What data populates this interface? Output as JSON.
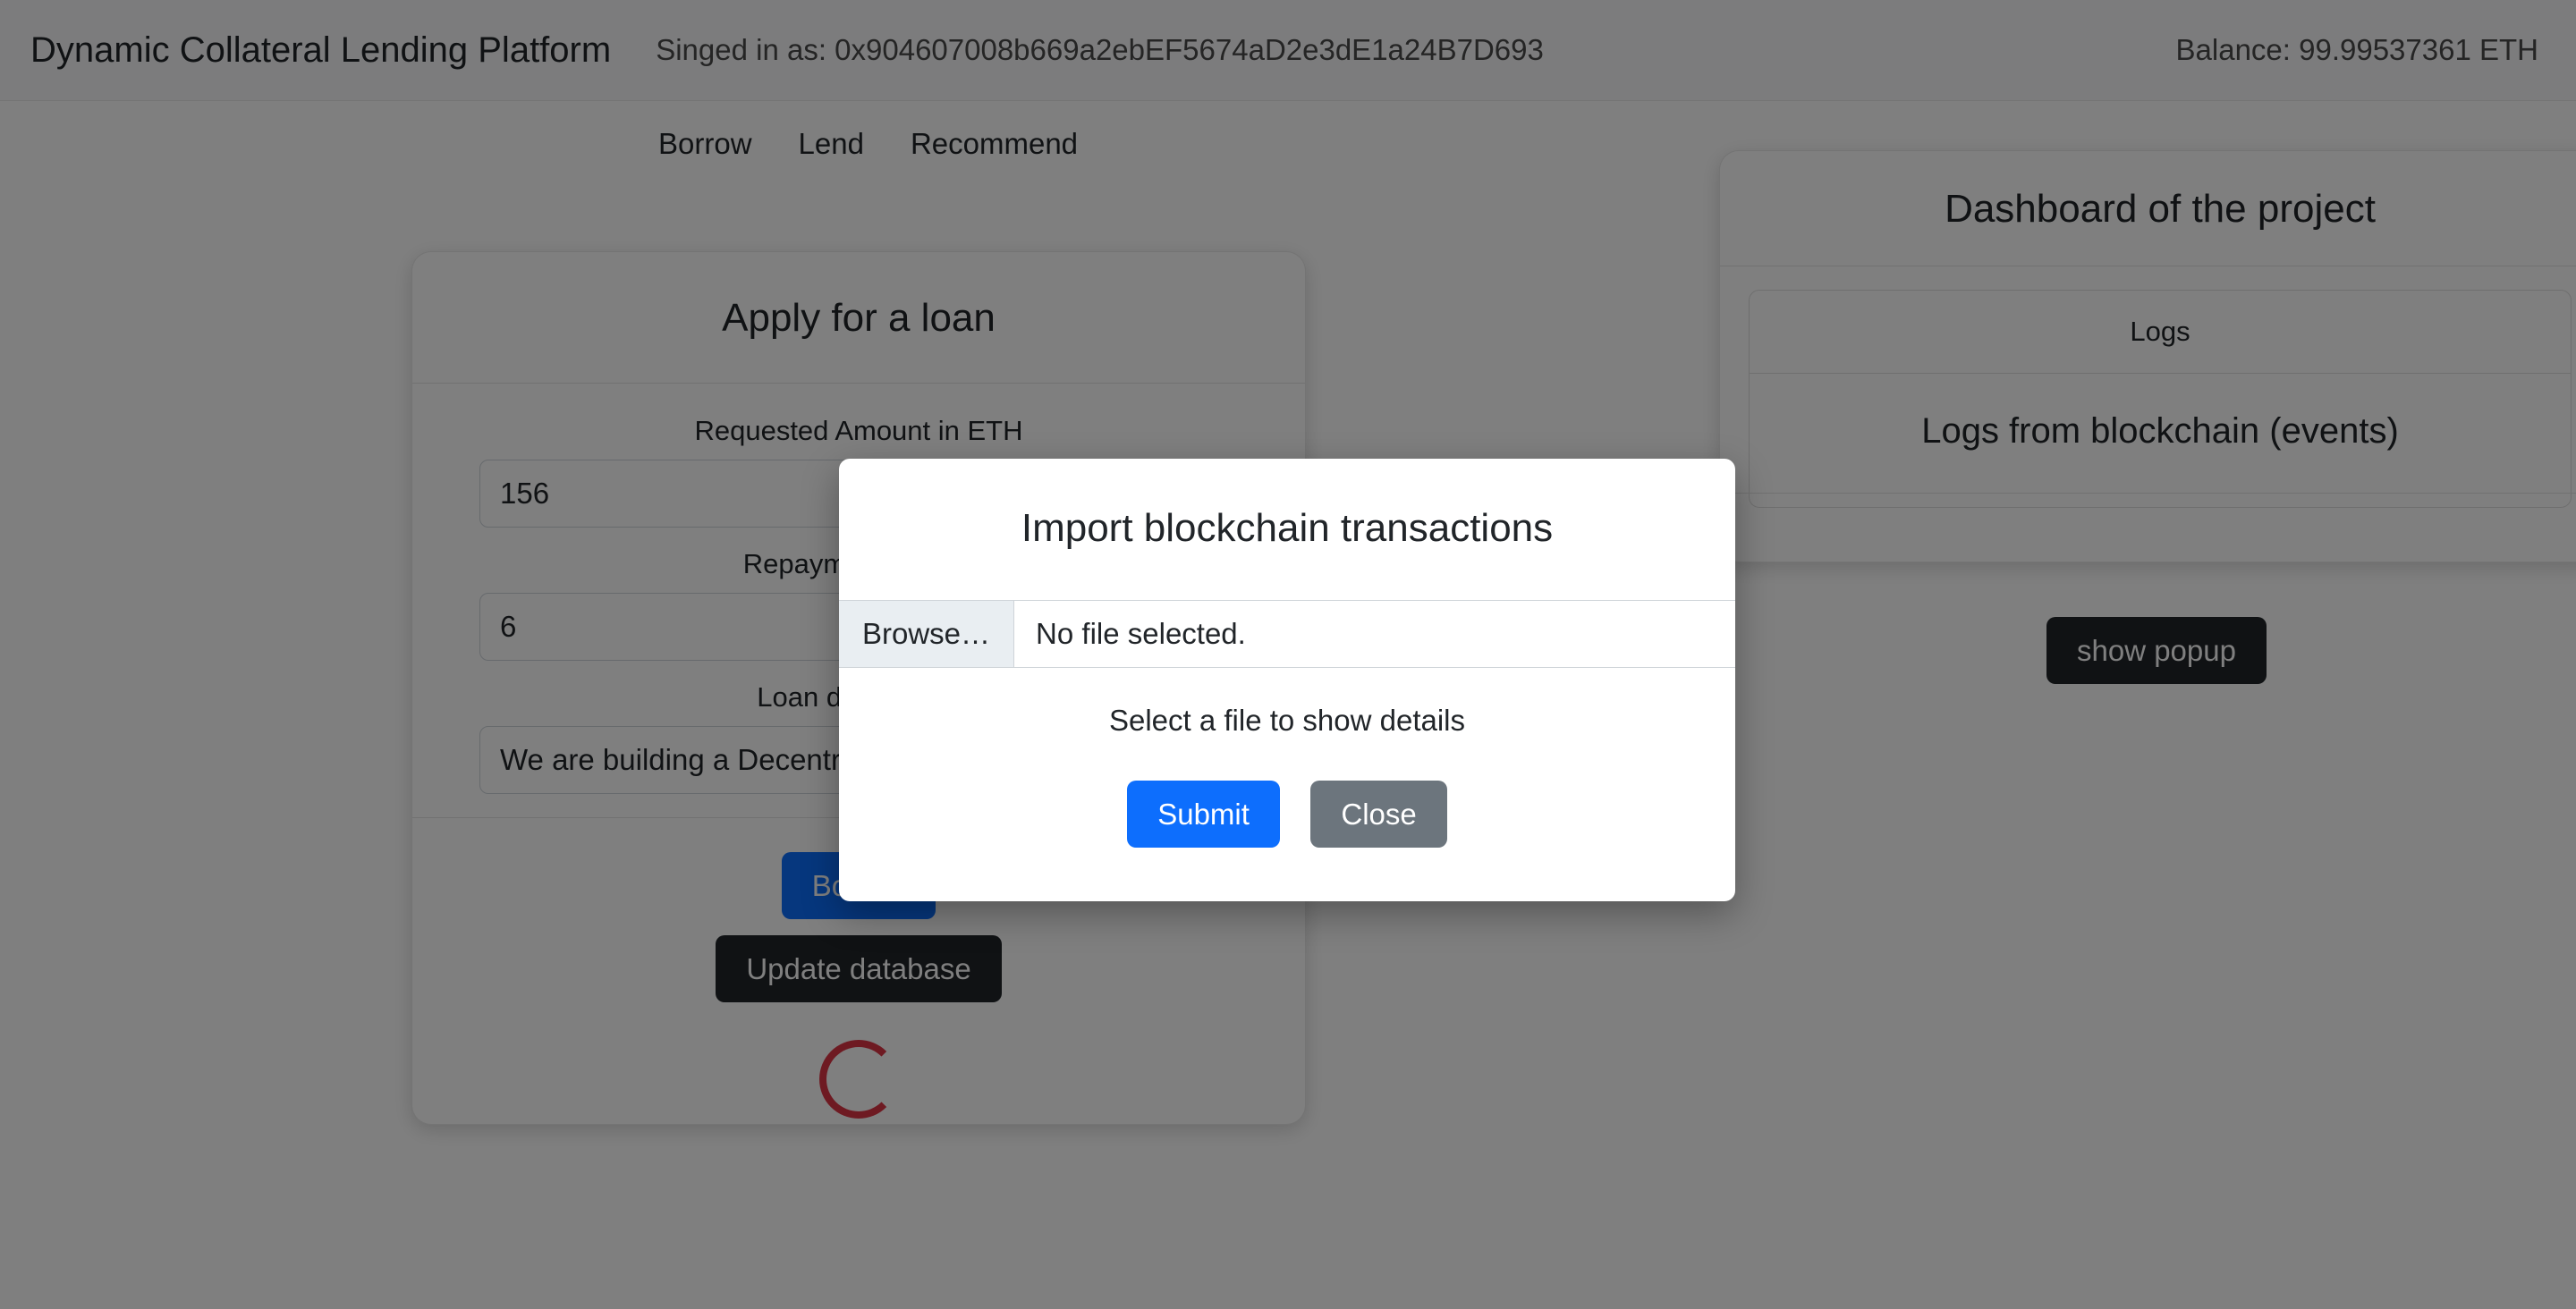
{
  "header": {
    "brand": "Dynamic Collateral Lending Platform",
    "signed_in": "Singed in as: 0x904607008b669a2ebEF5674aD2e3dE1a24B7D693",
    "balance": "Balance: 99.99537361 ETH"
  },
  "nav": {
    "tabs": [
      {
        "label": "Borrow"
      },
      {
        "label": "Lend"
      },
      {
        "label": "Recommend"
      }
    ]
  },
  "loan_card": {
    "title": "Apply for a loan",
    "fields": [
      {
        "label": "Requested Amount in ETH",
        "value": "156"
      },
      {
        "label": "Repayments count",
        "value": "6"
      },
      {
        "label": "Loan description",
        "value": "We are building a Decentralized app"
      }
    ],
    "borrow_button": "Borrow",
    "update_db_button": "Update database",
    "spinner": "loading-spinner"
  },
  "dashboard_card": {
    "title": "Dashboard of the project",
    "items": [
      {
        "label": "Logs"
      },
      {
        "label": "Logs from blockchain (events)"
      }
    ]
  },
  "show_popup_button": "show popup",
  "modal": {
    "title": "Import blockchain transactions",
    "browse_label": "Browse…",
    "file_name": "No file selected.",
    "hint": "Select a file to show details",
    "submit_label": "Submit",
    "close_label": "Close"
  },
  "colors": {
    "primary": "#0d6efd",
    "dark": "#212529",
    "secondary": "#6c757d",
    "spinner": "#dc3545",
    "backdrop": "rgba(0,0,0,0.5)"
  }
}
